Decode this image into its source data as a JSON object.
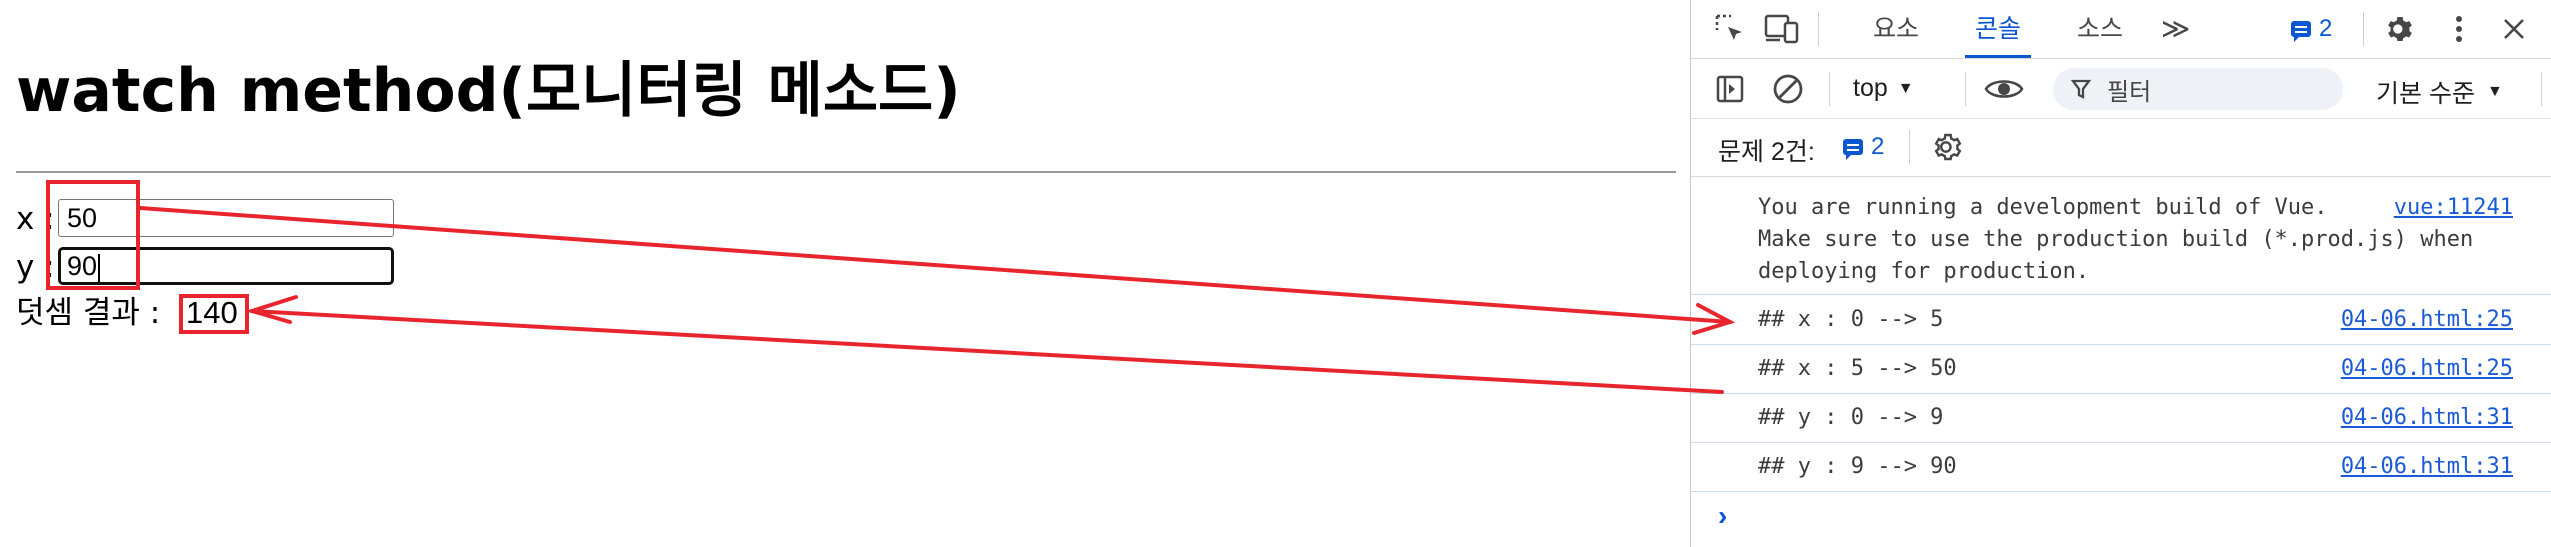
{
  "page": {
    "heading": "watch method(모니터링 메소드)",
    "x_label": "x :",
    "x_value": "50",
    "y_label": "y :",
    "y_value": "90",
    "sum_label": "덧셈 결과 :",
    "sum_value": "140"
  },
  "devtools": {
    "tabs": [
      "요소",
      "콘솔",
      "소스"
    ],
    "active_tab": "콘솔",
    "more_tabs": "≫",
    "issue_badge": "2",
    "context_selector": "top",
    "filter_placeholder": "필터",
    "level_selector": "기본 수준",
    "issues_label": "문제 2건:",
    "issues_count": "2",
    "logs": [
      {
        "text": "You are running a development build of Vue.\nMake sure to use the production build (*.prod.js) when\ndeploying for production.",
        "source": "vue:11241"
      },
      {
        "text": "## x : 0 --> 5",
        "source": "04-06.html:25"
      },
      {
        "text": "## x : 5 --> 50",
        "source": "04-06.html:25"
      },
      {
        "text": "## y : 0 --> 9",
        "source": "04-06.html:31"
      },
      {
        "text": "## y : 9 --> 90",
        "source": "04-06.html:31"
      }
    ],
    "prompt_symbol": "›"
  },
  "colors": {
    "annotation": "#e8252d",
    "accent": "#0b57d0",
    "link": "#1a5ad7"
  },
  "icons": [
    "inspect-icon",
    "device-toolbar-icon",
    "more-tabs-icon",
    "issues-badge-icon",
    "settings-gear-icon",
    "kebab-menu-icon",
    "close-icon",
    "sidebar-toggle-icon",
    "clear-console-icon",
    "eye-icon",
    "filter-funnel-icon",
    "chevron-down-icon"
  ]
}
